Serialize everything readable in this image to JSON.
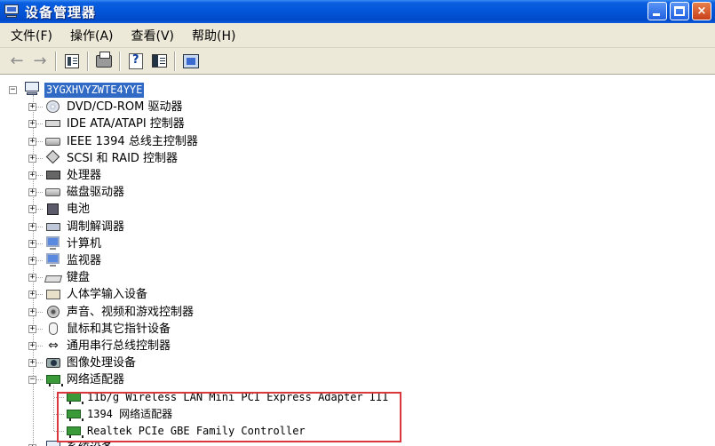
{
  "window": {
    "title": "设备管理器",
    "buttons": {
      "minimize": "_",
      "maximize": "□",
      "close": "×"
    }
  },
  "menu": [
    {
      "label": "文件(F)",
      "name": "menu-file"
    },
    {
      "label": "操作(A)",
      "name": "menu-action"
    },
    {
      "label": "查看(V)",
      "name": "menu-view"
    },
    {
      "label": "帮助(H)",
      "name": "menu-help"
    }
  ],
  "toolbar": {
    "back": "←",
    "forward": "→",
    "help_glyph": "?"
  },
  "tree": {
    "expand_sign": "+",
    "collapse_sign": "−",
    "root": {
      "label": "3YGXHVYZWTE4YYE",
      "expanded": true
    },
    "categories": [
      {
        "label": "DVD/CD-ROM 驱动器",
        "icon": "disc-icon",
        "expanded": false
      },
      {
        "label": "IDE ATA/ATAPI 控制器",
        "icon": "ide-controller-icon",
        "expanded": false
      },
      {
        "label": "IEEE 1394 总线主控制器",
        "icon": "ieee1394-icon",
        "expanded": false
      },
      {
        "label": "SCSI 和 RAID 控制器",
        "icon": "scsi-icon",
        "expanded": false
      },
      {
        "label": "处理器",
        "icon": "processor-icon",
        "expanded": false
      },
      {
        "label": "磁盘驱动器",
        "icon": "disk-drive-icon",
        "expanded": false
      },
      {
        "label": "电池",
        "icon": "battery-icon",
        "expanded": false
      },
      {
        "label": "调制解调器",
        "icon": "modem-icon",
        "expanded": false
      },
      {
        "label": "计算机",
        "icon": "computer-icon",
        "expanded": false
      },
      {
        "label": "监视器",
        "icon": "monitor-icon",
        "expanded": false
      },
      {
        "label": "键盘",
        "icon": "keyboard-icon",
        "expanded": false
      },
      {
        "label": "人体学输入设备",
        "icon": "hid-icon",
        "expanded": false
      },
      {
        "label": "声音、视频和游戏控制器",
        "icon": "sound-icon",
        "expanded": false
      },
      {
        "label": "鼠标和其它指针设备",
        "icon": "mouse-icon",
        "expanded": false
      },
      {
        "label": "通用串行总线控制器",
        "icon": "usb-icon",
        "expanded": false
      },
      {
        "label": "图像处理设备",
        "icon": "imaging-icon",
        "expanded": false
      },
      {
        "label": "网络适配器",
        "icon": "network-adapter-icon",
        "expanded": true
      }
    ],
    "network_children": [
      {
        "label": "11b/g Wireless LAN Mini PCI Express Adapter III"
      },
      {
        "label": "1394 网络适配器"
      },
      {
        "label": "Realtek PCIe GBE Family Controller"
      }
    ],
    "partial_last": {
      "label": "系统设备"
    }
  },
  "colors": {
    "titlebar": "#0355d8",
    "selection": "#316ac5",
    "highlight_box": "#d9363e",
    "chrome": "#ece9d8"
  }
}
